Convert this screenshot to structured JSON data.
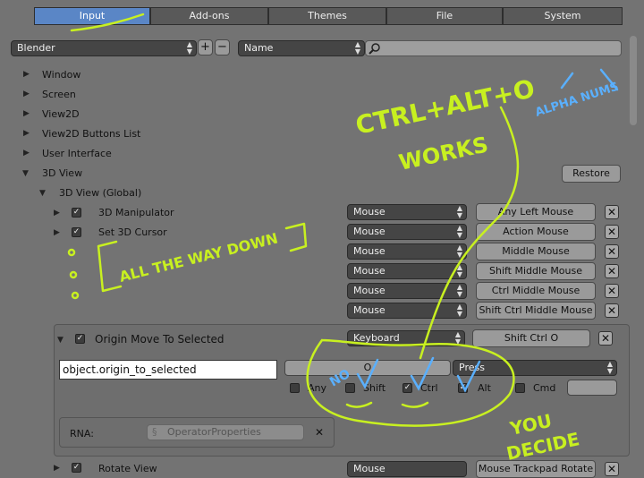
{
  "tabs": [
    {
      "label": "Input",
      "active": true
    },
    {
      "label": "Add-ons",
      "active": false
    },
    {
      "label": "Themes",
      "active": false
    },
    {
      "label": "File",
      "active": false
    },
    {
      "label": "System",
      "active": false
    }
  ],
  "toolbar": {
    "preset": "Blender",
    "plus": "+",
    "minus": "−",
    "search_mode": "Name",
    "search_value": ""
  },
  "tree": {
    "window": "Window",
    "screen": "Screen",
    "view2d": "View2D",
    "view2d_buttons": "View2D Buttons List",
    "user_interface": "User Interface",
    "view3d": "3D View",
    "view3d_global": "3D View (Global)",
    "restore": "Restore",
    "manipulator": "3D Manipulator",
    "set_cursor": "Set 3D Cursor",
    "rotate_view": "Rotate View"
  },
  "keymaps": [
    {
      "type": "Mouse",
      "key": "Any Left Mouse"
    },
    {
      "type": "Mouse",
      "key": "Action Mouse"
    },
    {
      "type": "Mouse",
      "key": "Middle Mouse"
    },
    {
      "type": "Mouse",
      "key": "Shift Middle Mouse"
    },
    {
      "type": "Mouse",
      "key": "Ctrl Middle Mouse"
    },
    {
      "type": "Mouse",
      "key": "Shift Ctrl Middle Mouse"
    }
  ],
  "expanded": {
    "title": "Origin Move To Selected",
    "type": "Keyboard",
    "key": "Shift Ctrl O",
    "operator": "object.origin_to_selected",
    "key_field": "O",
    "event": "Press",
    "any": "Any",
    "shift": "Shift",
    "ctrl": "Ctrl",
    "alt": "Alt",
    "cmd": "Cmd",
    "rna_label": "RNA:",
    "rna_value": "OperatorProperties"
  },
  "last_row": {
    "type": "Mouse",
    "key": "Mouse Trackpad Rotate"
  },
  "annotations": {
    "ctrl_alt_o": "CTRL+ALT+O",
    "works": "WORKS",
    "alpha_nums": "ALPHA NUMS",
    "all_the_way_down": "ALL THE WAY DOWN",
    "no": "NO",
    "you_decide_1": "YOU",
    "you_decide_2": "DECIDE"
  },
  "colors": {
    "background": "#737373",
    "active_tab": "#5a86c6",
    "annotation": "#c8f020",
    "annotation_blue": "#5ab0ff"
  }
}
